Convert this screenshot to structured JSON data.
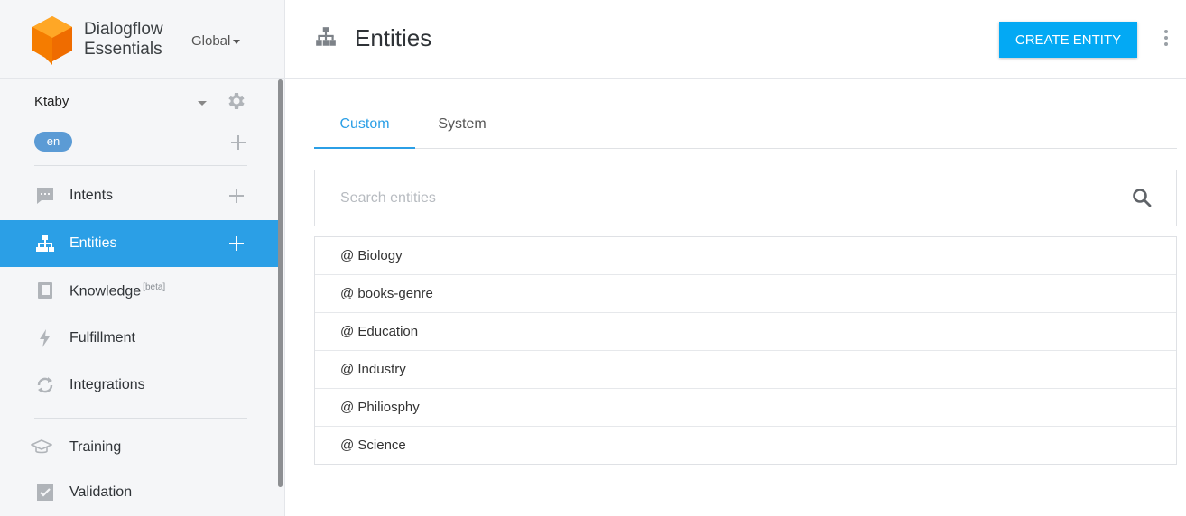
{
  "brand": {
    "name_line1": "Dialogflow",
    "name_line2": "Essentials",
    "region": "Global",
    "logo_color": "#f57c00"
  },
  "agent": {
    "name": "Ktaby",
    "language": "en"
  },
  "nav": {
    "items": [
      {
        "label": "Intents",
        "icon": "chat-icon",
        "has_add": true,
        "active": false
      },
      {
        "label": "Entities",
        "icon": "hierarchy-icon",
        "has_add": true,
        "active": true
      },
      {
        "label": "Knowledge",
        "icon": "book-icon",
        "badge": "[beta]",
        "active": false
      },
      {
        "label": "Fulfillment",
        "icon": "bolt-icon",
        "active": false
      },
      {
        "label": "Integrations",
        "icon": "sync-icon",
        "active": false
      },
      {
        "label": "Training",
        "icon": "graduation-cap-icon",
        "active": false
      },
      {
        "label": "Validation",
        "icon": "check-box-icon",
        "active": false
      }
    ]
  },
  "header": {
    "title": "Entities",
    "create_button": "CREATE ENTITY"
  },
  "tabs": [
    {
      "label": "Custom",
      "active": true
    },
    {
      "label": "System",
      "active": false
    }
  ],
  "search": {
    "placeholder": "Search entities",
    "value": ""
  },
  "entities": [
    "@ Biology",
    "@ books-genre",
    "@ Education",
    "@ Industry",
    "@ Philiosphy",
    "@ Science"
  ],
  "colors": {
    "accent": "#2b9fe6",
    "button": "#03a9f4",
    "language_pill": "#5b9bd5"
  }
}
